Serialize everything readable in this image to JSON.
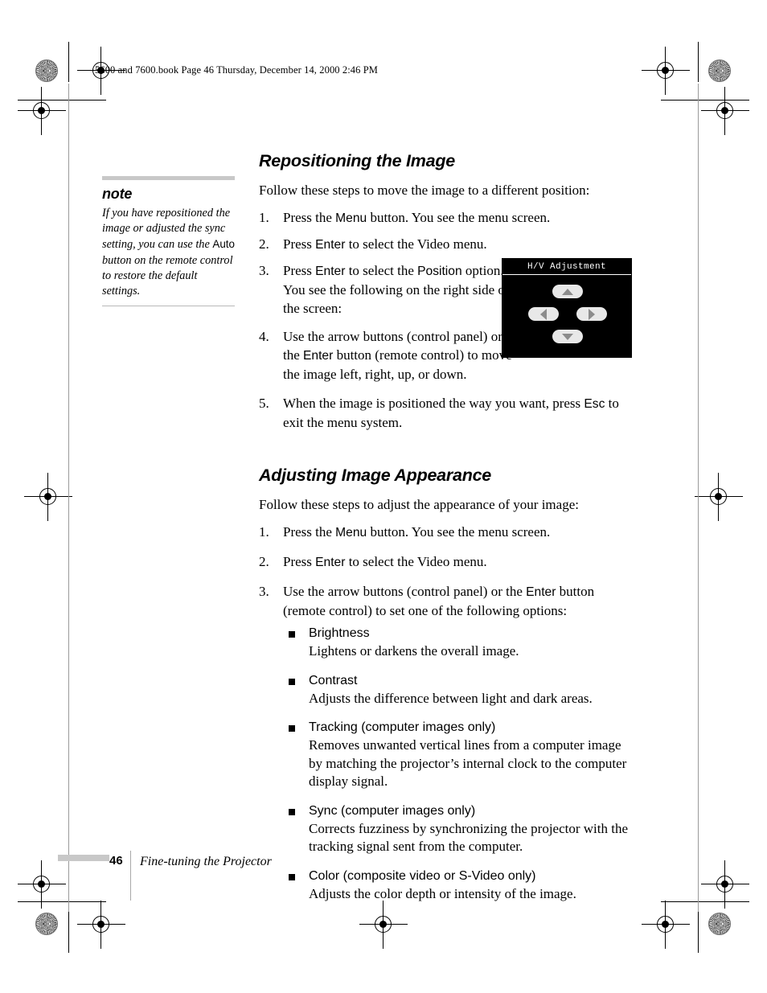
{
  "page": {
    "running_header": "5600 and 7600.book  Page 46  Thursday, December 14, 2000  2:46 PM",
    "footer_page_number": "46",
    "footer_title": "Fine-tuning the Projector"
  },
  "note": {
    "title": "note",
    "text_part1": "If you have repositioned the image or adjusted the sync setting, you can use the ",
    "key": "Auto",
    "text_part2": " button on the remote control to restore the default settings."
  },
  "section1": {
    "heading": "Repositioning the Image",
    "lead": "Follow these steps to move the image to a different position:",
    "steps": [
      {
        "num": "1.",
        "pre": "Press the ",
        "key": "Menu",
        "post": " button. You see the menu screen."
      },
      {
        "num": "2.",
        "pre": "Press ",
        "key": "Enter",
        "post": " to select the Video menu."
      },
      {
        "num": "3.",
        "pre": "Press ",
        "key": "Enter",
        "mid": " to select the ",
        "key2": "Position",
        "post": " option. You see the following on the right side of the screen:"
      },
      {
        "num": "4.",
        "pre": "Use the arrow buttons (control panel) or the ",
        "key": "Enter",
        "post": " button (remote control) to move the image left, right, up, or down."
      },
      {
        "num": "5.",
        "pre": "When the image is positioned the way you want, press ",
        "key": "Esc",
        "post": " to exit the menu system."
      }
    ]
  },
  "osd": {
    "title": "H/V Adjustment",
    "buttons": [
      "up-arrow",
      "left-arrow",
      "right-arrow",
      "down-arrow"
    ]
  },
  "section2": {
    "heading": "Adjusting Image Appearance",
    "lead": "Follow these steps to adjust the appearance of your image:",
    "steps": [
      {
        "num": "1.",
        "pre": "Press the ",
        "key": "Menu",
        "post": " button. You see the menu screen."
      },
      {
        "num": "2.",
        "pre": "Press ",
        "key": "Enter",
        "post": " to select the Video menu."
      },
      {
        "num": "3.",
        "pre": "Use the arrow buttons (control panel) or the ",
        "key": "Enter",
        "post": " button (remote control) to set one of the following options:"
      }
    ],
    "options": [
      {
        "name": "Brightness",
        "desc": "Lightens or darkens the overall image."
      },
      {
        "name": "Contrast",
        "desc": "Adjusts the difference between light and dark areas."
      },
      {
        "name": "Tracking (computer images only)",
        "desc": "Removes unwanted vertical lines from a computer image by matching the projector’s internal clock to the computer display signal."
      },
      {
        "name": "Sync (computer images only)",
        "desc": "Corrects fuzziness by synchronizing the projector with the tracking signal sent from the computer."
      },
      {
        "name": "Color (composite video or S-Video only)",
        "desc": "Adjusts the color depth or intensity of the image."
      }
    ]
  },
  "colors": {
    "rule_gray": "#c8c8c8",
    "osd_background": "#000000",
    "osd_button": "#e8e8e8"
  }
}
